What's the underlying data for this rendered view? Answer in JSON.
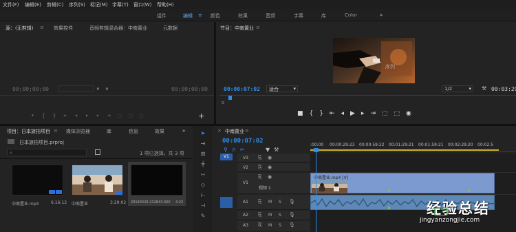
{
  "menu": [
    "文件(F)",
    "编辑(E)",
    "剪辑(C)",
    "序列(S)",
    "标记(M)",
    "字幕(T)",
    "窗口(W)",
    "帮助(H)"
  ],
  "workspaces": {
    "items": [
      "组件",
      "编辑",
      "颜色",
      "效果",
      "音频",
      "字幕",
      "库",
      "Color"
    ],
    "active": "编辑",
    "more": "»"
  },
  "source_panel": {
    "tabs": [
      "源：(无剪辑)",
      "效果控件",
      "音频剪辑混合器：中南置业",
      "元数据"
    ],
    "tc_left": "00;00;00;00",
    "tc_right": "00;00;00;00"
  },
  "program_panel": {
    "title": "节目：中南置业",
    "tc_current": "00:00:07:02",
    "fit": "适合",
    "quality": "1/2",
    "tc_duration": "00:03:29",
    "watermark": "序列"
  },
  "project_panel": {
    "tabs": [
      "项目：日本旅拍项目",
      "媒体浏览器",
      "库",
      "信息",
      "效果"
    ],
    "file": "日本旅拍项目.prproj",
    "selection": "1 项已选择，共 3 项",
    "items": [
      {
        "name": "中南置业.mp4",
        "duration": "6:16:12"
      },
      {
        "name": "中南置业",
        "duration": "3:29:02"
      },
      {
        "name": "20190329-232843-0000...",
        "duration": "4:22"
      }
    ]
  },
  "timeline": {
    "title": "中南置业",
    "tc": "00:00:07:02",
    "ruler": [
      ":00:00",
      "00:00:29:23",
      "00:00:59:22",
      "00:01:29:21",
      "00:01:59:21",
      "00:02:29:20",
      "00:02:5"
    ],
    "video_tracks": [
      "V3",
      "V2",
      "V1"
    ],
    "v1_label": "视频 1",
    "audio_tracks": [
      "A1",
      "A2",
      "A3"
    ],
    "src_patch_v": "V1",
    "clip_label": "中南置业.mp4 [V]",
    "mute": "M",
    "solo": "S"
  },
  "watermark": {
    "title": "经验总结",
    "url": "jingyanzongjie.com"
  }
}
